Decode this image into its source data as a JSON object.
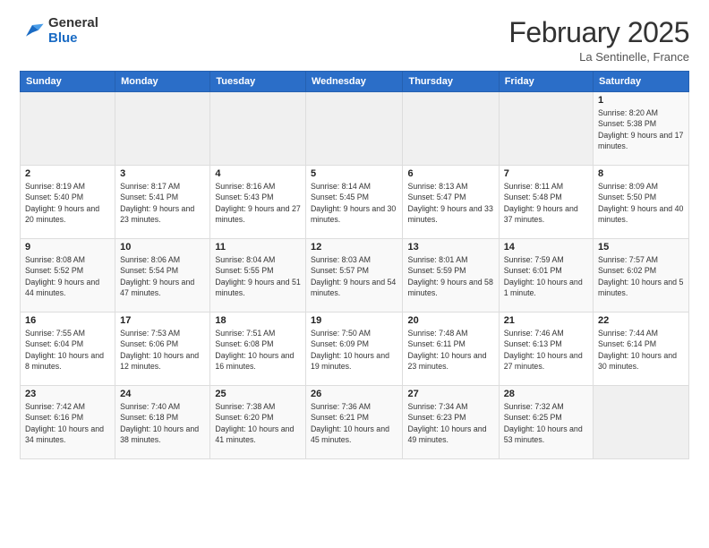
{
  "header": {
    "logo": {
      "general": "General",
      "blue": "Blue"
    },
    "title": "February 2025",
    "location": "La Sentinelle, France"
  },
  "days_of_week": [
    "Sunday",
    "Monday",
    "Tuesday",
    "Wednesday",
    "Thursday",
    "Friday",
    "Saturday"
  ],
  "weeks": [
    [
      {
        "num": "",
        "info": ""
      },
      {
        "num": "",
        "info": ""
      },
      {
        "num": "",
        "info": ""
      },
      {
        "num": "",
        "info": ""
      },
      {
        "num": "",
        "info": ""
      },
      {
        "num": "",
        "info": ""
      },
      {
        "num": "1",
        "info": "Sunrise: 8:20 AM\nSunset: 5:38 PM\nDaylight: 9 hours\nand 17 minutes."
      }
    ],
    [
      {
        "num": "2",
        "info": "Sunrise: 8:19 AM\nSunset: 5:40 PM\nDaylight: 9 hours\nand 20 minutes."
      },
      {
        "num": "3",
        "info": "Sunrise: 8:17 AM\nSunset: 5:41 PM\nDaylight: 9 hours\nand 23 minutes."
      },
      {
        "num": "4",
        "info": "Sunrise: 8:16 AM\nSunset: 5:43 PM\nDaylight: 9 hours\nand 27 minutes."
      },
      {
        "num": "5",
        "info": "Sunrise: 8:14 AM\nSunset: 5:45 PM\nDaylight: 9 hours\nand 30 minutes."
      },
      {
        "num": "6",
        "info": "Sunrise: 8:13 AM\nSunset: 5:47 PM\nDaylight: 9 hours\nand 33 minutes."
      },
      {
        "num": "7",
        "info": "Sunrise: 8:11 AM\nSunset: 5:48 PM\nDaylight: 9 hours\nand 37 minutes."
      },
      {
        "num": "8",
        "info": "Sunrise: 8:09 AM\nSunset: 5:50 PM\nDaylight: 9 hours\nand 40 minutes."
      }
    ],
    [
      {
        "num": "9",
        "info": "Sunrise: 8:08 AM\nSunset: 5:52 PM\nDaylight: 9 hours\nand 44 minutes."
      },
      {
        "num": "10",
        "info": "Sunrise: 8:06 AM\nSunset: 5:54 PM\nDaylight: 9 hours\nand 47 minutes."
      },
      {
        "num": "11",
        "info": "Sunrise: 8:04 AM\nSunset: 5:55 PM\nDaylight: 9 hours\nand 51 minutes."
      },
      {
        "num": "12",
        "info": "Sunrise: 8:03 AM\nSunset: 5:57 PM\nDaylight: 9 hours\nand 54 minutes."
      },
      {
        "num": "13",
        "info": "Sunrise: 8:01 AM\nSunset: 5:59 PM\nDaylight: 9 hours\nand 58 minutes."
      },
      {
        "num": "14",
        "info": "Sunrise: 7:59 AM\nSunset: 6:01 PM\nDaylight: 10 hours\nand 1 minute."
      },
      {
        "num": "15",
        "info": "Sunrise: 7:57 AM\nSunset: 6:02 PM\nDaylight: 10 hours\nand 5 minutes."
      }
    ],
    [
      {
        "num": "16",
        "info": "Sunrise: 7:55 AM\nSunset: 6:04 PM\nDaylight: 10 hours\nand 8 minutes."
      },
      {
        "num": "17",
        "info": "Sunrise: 7:53 AM\nSunset: 6:06 PM\nDaylight: 10 hours\nand 12 minutes."
      },
      {
        "num": "18",
        "info": "Sunrise: 7:51 AM\nSunset: 6:08 PM\nDaylight: 10 hours\nand 16 minutes."
      },
      {
        "num": "19",
        "info": "Sunrise: 7:50 AM\nSunset: 6:09 PM\nDaylight: 10 hours\nand 19 minutes."
      },
      {
        "num": "20",
        "info": "Sunrise: 7:48 AM\nSunset: 6:11 PM\nDaylight: 10 hours\nand 23 minutes."
      },
      {
        "num": "21",
        "info": "Sunrise: 7:46 AM\nSunset: 6:13 PM\nDaylight: 10 hours\nand 27 minutes."
      },
      {
        "num": "22",
        "info": "Sunrise: 7:44 AM\nSunset: 6:14 PM\nDaylight: 10 hours\nand 30 minutes."
      }
    ],
    [
      {
        "num": "23",
        "info": "Sunrise: 7:42 AM\nSunset: 6:16 PM\nDaylight: 10 hours\nand 34 minutes."
      },
      {
        "num": "24",
        "info": "Sunrise: 7:40 AM\nSunset: 6:18 PM\nDaylight: 10 hours\nand 38 minutes."
      },
      {
        "num": "25",
        "info": "Sunrise: 7:38 AM\nSunset: 6:20 PM\nDaylight: 10 hours\nand 41 minutes."
      },
      {
        "num": "26",
        "info": "Sunrise: 7:36 AM\nSunset: 6:21 PM\nDaylight: 10 hours\nand 45 minutes."
      },
      {
        "num": "27",
        "info": "Sunrise: 7:34 AM\nSunset: 6:23 PM\nDaylight: 10 hours\nand 49 minutes."
      },
      {
        "num": "28",
        "info": "Sunrise: 7:32 AM\nSunset: 6:25 PM\nDaylight: 10 hours\nand 53 minutes."
      },
      {
        "num": "",
        "info": ""
      }
    ]
  ]
}
